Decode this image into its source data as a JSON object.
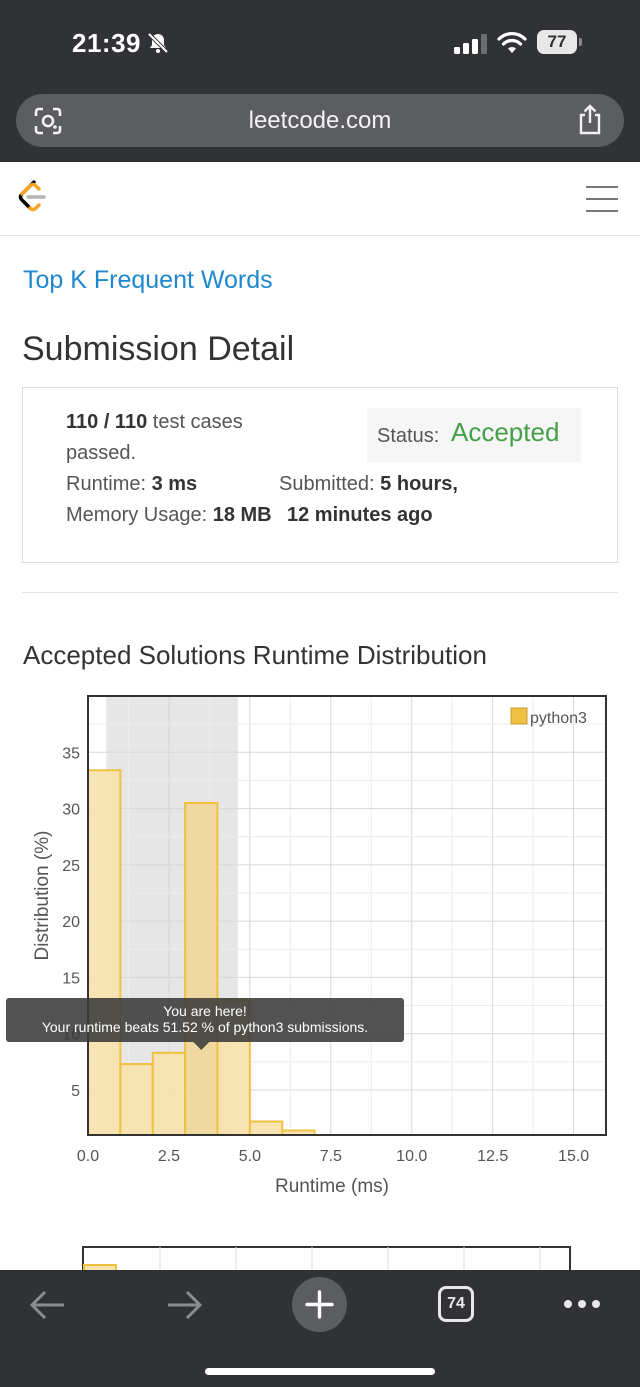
{
  "status_bar": {
    "time": "21:39",
    "battery": "77",
    "icons": [
      "bell-slash-icon",
      "signal-icon",
      "wifi-icon",
      "battery-icon"
    ]
  },
  "browser": {
    "url": "leetcode.com",
    "tab_count": "74",
    "icons": [
      "lens-icon",
      "share-icon",
      "back-icon",
      "forward-icon",
      "plus-icon",
      "tabs-icon",
      "more-icon"
    ]
  },
  "header": {
    "logo": "leetcode-logo-icon",
    "menu_icon": "hamburger-menu-icon"
  },
  "problem": {
    "title": "Top K Frequent Words"
  },
  "page": {
    "title": "Submission Detail"
  },
  "submission": {
    "passed_count": "110 / 110",
    "passed_suffix": " test cases",
    "passed_line2": "passed.",
    "status_label": "Status: ",
    "status_value": "Accepted",
    "runtime_label": "Runtime: ",
    "runtime_value": "3 ms",
    "submitted_label": "Submitted: ",
    "submitted_value_1": "5 hours,",
    "memory_label": "Memory Usage: ",
    "memory_value": "18 MB",
    "submitted_value_2": "12 minutes ago"
  },
  "chart_section": {
    "title": "Accepted Solutions Runtime Distribution"
  },
  "chart_data": {
    "type": "bar",
    "xlabel": "Runtime (ms)",
    "ylabel": "Distribution (%)",
    "xlim": [
      0,
      16
    ],
    "ylim": [
      1,
      40
    ],
    "x_ticks": [
      0.0,
      2.5,
      5.0,
      7.5,
      10.0,
      12.5,
      15.0
    ],
    "x_tick_labels": [
      "0.0",
      "2.5",
      "5.0",
      "7.5",
      "10.0",
      "12.5",
      "15.0"
    ],
    "y_ticks": [
      5,
      10,
      15,
      20,
      25,
      30,
      35
    ],
    "y_tick_labels": [
      "5",
      "10",
      "15",
      "20",
      "25",
      "30",
      "35"
    ],
    "grid": true,
    "legend_position": "top-right",
    "series": [
      {
        "name": "python3",
        "color": "#f0c040",
        "bins": [
          {
            "x0": 0,
            "x1": 1,
            "value": 33.4
          },
          {
            "x0": 1,
            "x1": 2,
            "value": 7.3
          },
          {
            "x0": 2,
            "x1": 3,
            "value": 8.3
          },
          {
            "x0": 3,
            "x1": 4,
            "value": 30.5
          },
          {
            "x0": 4,
            "x1": 5,
            "value": 13.0
          },
          {
            "x0": 5,
            "x1": 6,
            "value": 2.2
          },
          {
            "x0": 6,
            "x1": 7,
            "value": 1.4
          }
        ]
      }
    ],
    "highlight_range": [
      1,
      5
    ],
    "highlight_bin_index": 3,
    "tooltip": {
      "title": "You are here!",
      "text": "Your runtime beats 51.52 % of python3 submissions."
    }
  }
}
